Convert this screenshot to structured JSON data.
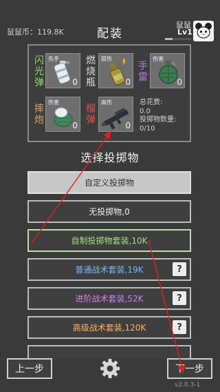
{
  "header": {
    "currency_label": "鼠鼠币：119.8K",
    "title": "配装",
    "player_name": "鼠鼠",
    "player_level": "Lv1",
    "level_progress": 0.3
  },
  "loadout": {
    "slots": [
      {
        "label": "闪光弹",
        "label_color": "#8fd46e",
        "tag": "先手",
        "count": "0",
        "icon": "flashbang-icon"
      },
      {
        "label": "燃烧瓶",
        "label_color": "#e0e0e0",
        "tag": "提伤",
        "count": "0",
        "icon": "molotov-icon"
      },
      {
        "label": "手雷",
        "label_color": "#b07ce0",
        "tag": "伤害",
        "count": "0",
        "icon": "grenade-icon"
      },
      {
        "label": "摔炮",
        "label_color": "#e0a060",
        "tag": "伤害",
        "count": "0",
        "icon": "snap-bomb-icon"
      },
      {
        "label": "榴弹",
        "label_color": "#e05050",
        "tag": "高伤",
        "count": "0",
        "icon": "grenade-launcher-icon"
      }
    ],
    "stats": {
      "total_cost_label": "总花费:",
      "total_cost_value": "0.0",
      "throw_count_label": "投掷物数量:",
      "throw_count_value": "0/10"
    }
  },
  "select": {
    "heading": "选择投掷物",
    "options": [
      {
        "label": "自定义投掷物"
      },
      {
        "label": "无投掷物,0"
      },
      {
        "label": "自制投掷物套装,10K"
      },
      {
        "label": "普通战术套装,19K",
        "help": "?"
      },
      {
        "label": "进阶战术套装,52K",
        "help": "?"
      },
      {
        "label": "高级战术套装,120K",
        "help": "?"
      }
    ]
  },
  "footer": {
    "prev_label": "上一步",
    "next_label": "下一步",
    "version": "v2.0.3-1"
  },
  "colors": {
    "background": "#3a3a3a",
    "annotation_arrow": "#e0221a"
  }
}
